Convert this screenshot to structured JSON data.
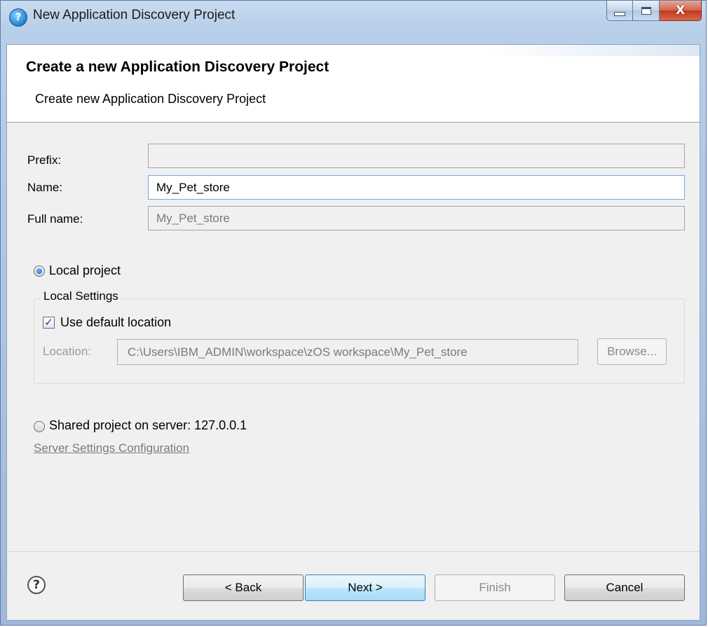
{
  "window": {
    "title": "New Application Discovery Project",
    "icon": "app-icon",
    "controls": [
      "minimize",
      "maximize",
      "close"
    ]
  },
  "banner": {
    "title": "Create a new Application Discovery Project",
    "subtitle": "Create new Application Discovery Project"
  },
  "form": {
    "prefix_label": "Prefix:",
    "prefix_value": "",
    "name_label": "Name:",
    "name_value": "My_Pet_store",
    "fullname_label": "Full name:",
    "fullname_value": "My_Pet_store"
  },
  "local": {
    "radio_label": "Local project",
    "selected": true,
    "group_title": "Local Settings",
    "use_default_label": "Use default location",
    "use_default_checked": true,
    "location_label": "Location:",
    "location_value": "C:\\Users\\IBM_ADMIN\\workspace\\zOS workspace\\My_Pet_store",
    "browse_label": "Browse..."
  },
  "shared": {
    "radio_label": "Shared project on server: 127.0.0.1",
    "selected": false,
    "settings_link": "Server Settings Configuration"
  },
  "footer": {
    "help": "?",
    "back_label": "< Back",
    "next_label": "Next >",
    "finish_label": "Finish",
    "cancel_label": "Cancel"
  }
}
